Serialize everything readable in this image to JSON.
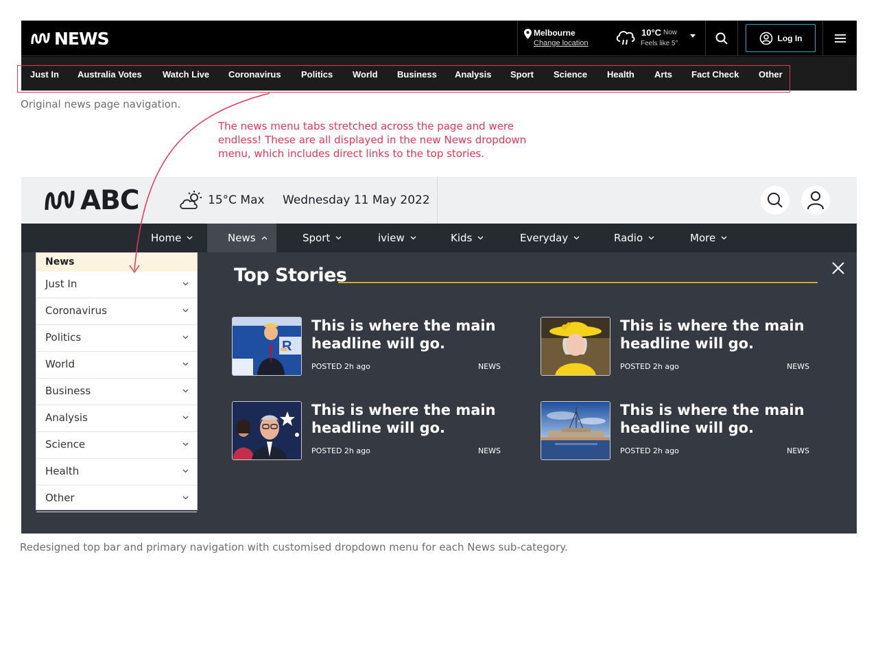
{
  "original": {
    "logo_text": "NEWS",
    "location": {
      "city": "Melbourne",
      "change_label": "Change location"
    },
    "weather": {
      "temp": "10°C",
      "now": "Now",
      "feels_like": "Feels like 5°"
    },
    "login_label": "Log In",
    "nav": [
      "Just In",
      "Australia Votes",
      "Watch Live",
      "Coronavirus",
      "Politics",
      "World",
      "Business",
      "Analysis",
      "Sport",
      "Science",
      "Health",
      "Arts",
      "Fact Check",
      "Other"
    ],
    "caption": "Original news page navigation."
  },
  "annotation": "The news menu tabs stretched across the page and were endless! These are all displayed in the new News dropdown menu, which includes direct links to the top stories.",
  "redesign": {
    "logo_text": "ABC",
    "weather": "15°C Max",
    "date": "Wednesday 11 May 2022",
    "nav": [
      "Home",
      "News",
      "Sport",
      "iview",
      "Kids",
      "Everyday",
      "Radio",
      "More"
    ],
    "active_nav": "News",
    "dropdown": {
      "heading": "News",
      "items": [
        "Just In",
        "Coronavirus",
        "Politics",
        "World",
        "Business",
        "Analysis",
        "Science",
        "Health",
        "Other"
      ]
    },
    "top_stories": {
      "title": "Top Stories",
      "stories": [
        {
          "headline": "This is where the main headline will go.",
          "posted": "POSTED 2h ago",
          "tag": "NEWS",
          "image": "politician-speaking-photo"
        },
        {
          "headline": "This is where the main headline will go.",
          "posted": "POSTED 2h ago",
          "tag": "NEWS",
          "image": "queen-yellow-hat-photo"
        },
        {
          "headline": "This is where the main headline will go.",
          "posted": "POSTED 2h ago",
          "tag": "NEWS",
          "image": "politicians-flag-photo"
        },
        {
          "headline": "This is where the main headline will go.",
          "posted": "POSTED 2h ago",
          "tag": "NEWS",
          "image": "parliament-house-photo"
        }
      ]
    },
    "caption": "Redesigned top bar and primary navigation with customised dropdown menu for each News sub-category."
  },
  "colors": {
    "annotation_red": "#e8355a",
    "accent_gold": "#d5a72b",
    "panel_bg": "#353941",
    "nav_bg": "#262a31",
    "login_border": "#2aa7d6"
  }
}
